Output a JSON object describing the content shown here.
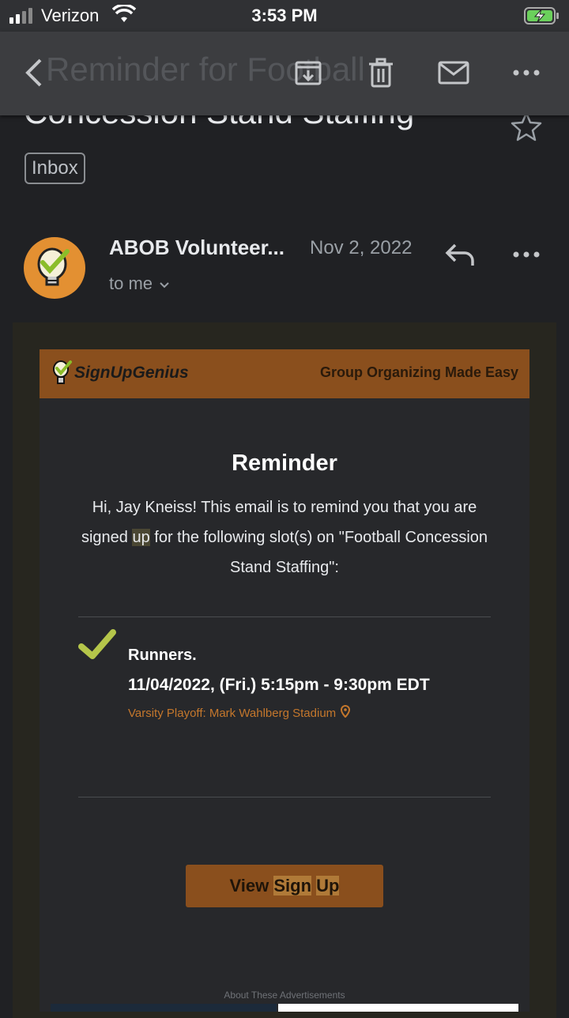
{
  "status_bar": {
    "carrier": "Verizon",
    "time": "3:53 PM"
  },
  "app_bar": {
    "faded_subject": "Reminder for Football"
  },
  "message": {
    "subject": "Concession Stand Staffing",
    "label": "Inbox",
    "sender": "ABOB Volunteer...",
    "date": "Nov 2, 2022",
    "recipient": "to me"
  },
  "email": {
    "brand": "SignUpGenius",
    "tagline": "Group Organizing Made Easy",
    "heading": "Reminder",
    "intro_before_hl": "Hi, Jay Kneiss! This email is to remind you that you are signed ",
    "intro_hl": "up",
    "intro_after_hl": " for the following slot(s) on \"Football Concession Stand Staffing\":",
    "slot": {
      "title": "Runners.",
      "time": "11/04/2022, (Fri.) 5:15pm - 9:30pm EDT",
      "location": "Varsity Playoff: Mark Wahlberg Stadium"
    },
    "cta_part1": "View ",
    "cta_hl1": "Sign",
    "cta_space": " ",
    "cta_hl2": "Up",
    "ads_label": "About These Advertisements"
  },
  "colors": {
    "background": "#202124",
    "brand_orange": "#8a4f1d",
    "check_green": "#b5c64a",
    "location_orange": "#c4772c"
  },
  "icons": [
    "back-arrow-icon",
    "archive-icon",
    "trash-icon",
    "mail-icon",
    "more-icon",
    "star-icon",
    "reply-icon",
    "chevron-down-icon",
    "check-icon",
    "location-pin-icon"
  ]
}
